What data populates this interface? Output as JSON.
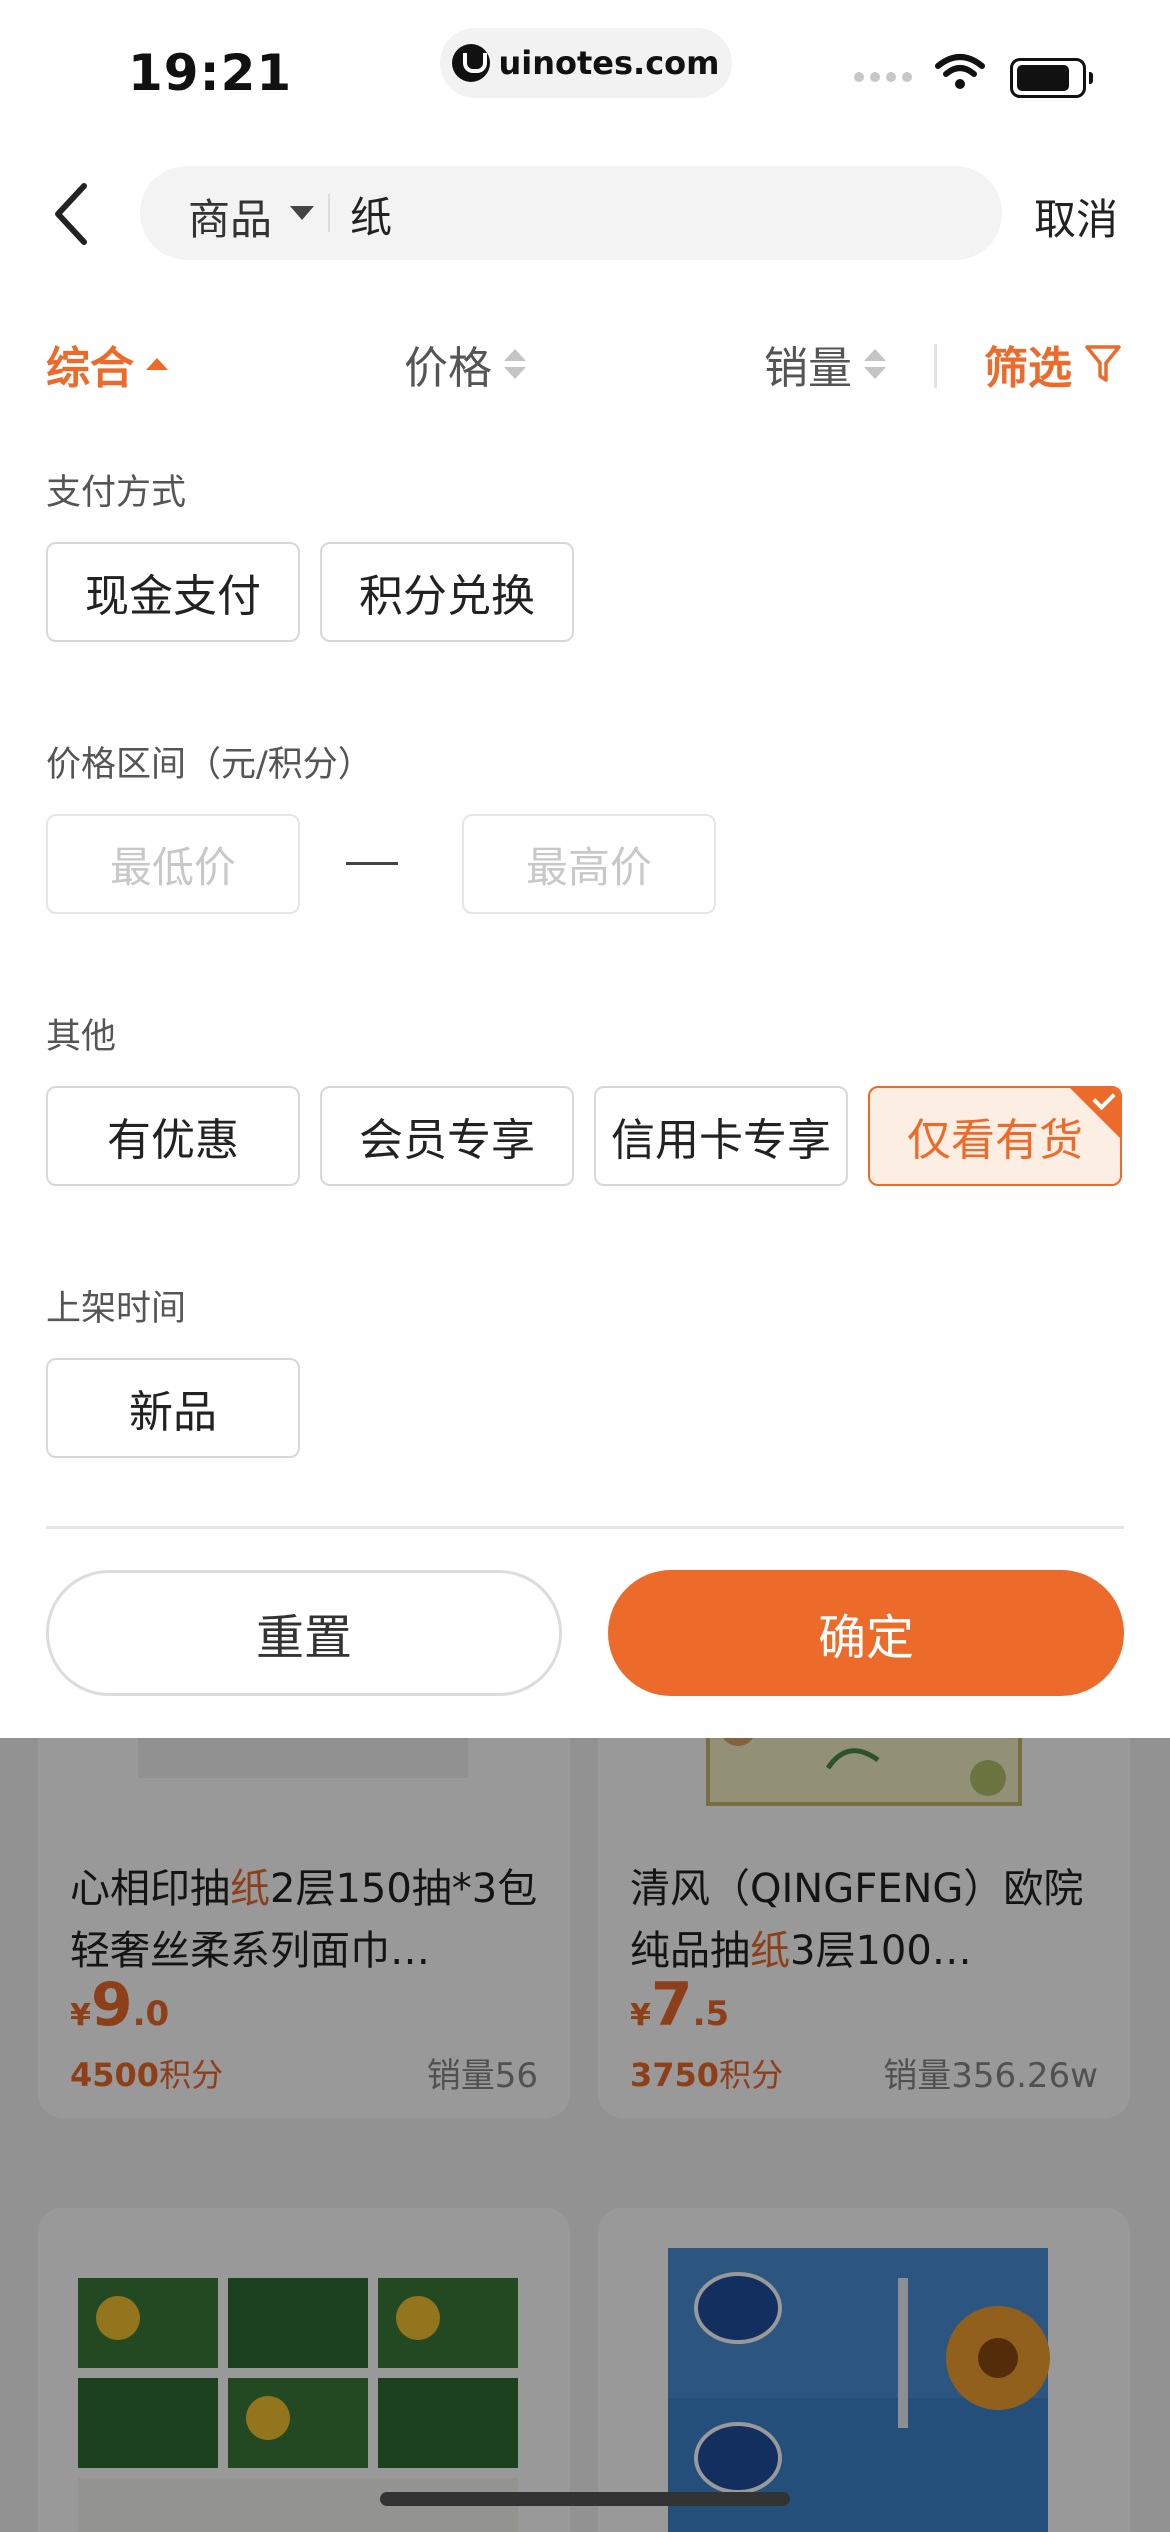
{
  "status_bar": {
    "time": "19:21",
    "url": "uinotes.com"
  },
  "search": {
    "scope": "商品",
    "query": "纸",
    "cancel_label": "取消"
  },
  "sort_bar": {
    "items": [
      {
        "label": "综合",
        "active": true
      },
      {
        "label": "价格",
        "active": false
      },
      {
        "label": "销量",
        "active": false
      }
    ],
    "filter_label": "筛选"
  },
  "filters": {
    "payment": {
      "title": "支付方式",
      "options": [
        "现金支付",
        "积分兑换"
      ]
    },
    "price_range": {
      "title": "价格区间（元/积分）",
      "min_placeholder": "最低价",
      "max_placeholder": "最高价"
    },
    "other": {
      "title": "其他",
      "options": [
        "有优惠",
        "会员专享",
        "信用卡专享",
        "仅看有货"
      ],
      "selected": "仅看有货"
    },
    "listing_time": {
      "title": "上架时间",
      "options": [
        "新品"
      ]
    }
  },
  "actions": {
    "reset_label": "重置",
    "confirm_label": "确定"
  },
  "products": [
    {
      "title_pre": "心相印抽",
      "title_hl": "纸",
      "title_post": "2层150抽*3包轻奢丝柔系列面巾…",
      "currency": "¥",
      "price_int": "9",
      "price_dec": ".0",
      "points_num": "4500",
      "points_unit": "积分",
      "sales": "销量56"
    },
    {
      "title_pre": "清风（QINGFENG）欧院纯品抽",
      "title_hl": "纸",
      "title_post": "3层100…",
      "currency": "¥",
      "price_int": "7",
      "price_dec": ".5",
      "points_num": "3750",
      "points_unit": "积分",
      "sales": "销量356.26w"
    }
  ],
  "colors": {
    "accent": "#ec6a2a",
    "selected_bg": "#fdeee4"
  }
}
